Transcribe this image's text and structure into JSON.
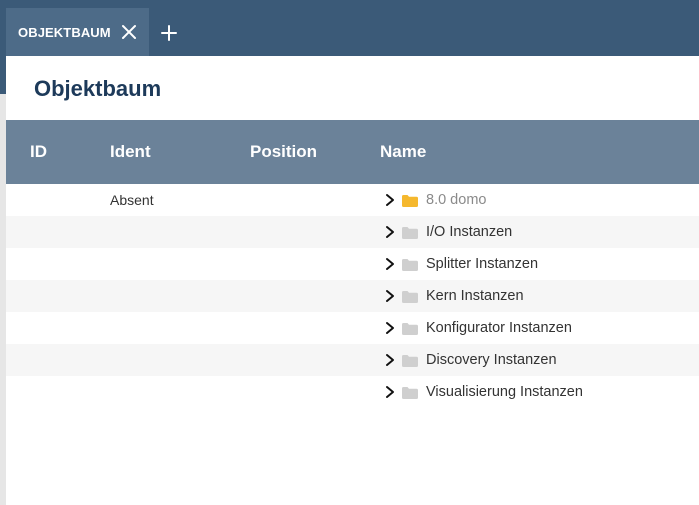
{
  "tab": {
    "label": "OBJEKTBAUM",
    "close_icon": "close-icon",
    "add_icon": "plus-icon"
  },
  "page": {
    "title": "Objektbaum"
  },
  "table": {
    "columns": [
      "ID",
      "Ident",
      "Position",
      "Name"
    ],
    "rows": [
      {
        "id": "",
        "ident": "Absent",
        "position": "",
        "name": "8.0 domo",
        "folder_color": "#f5b82e",
        "muted": true
      },
      {
        "id": "",
        "ident": "",
        "position": "",
        "name": "I/O Instanzen",
        "folder_color": "#cfcfcf",
        "muted": false
      },
      {
        "id": "",
        "ident": "",
        "position": "",
        "name": "Splitter Instanzen",
        "folder_color": "#cfcfcf",
        "muted": false
      },
      {
        "id": "",
        "ident": "",
        "position": "",
        "name": "Kern Instanzen",
        "folder_color": "#cfcfcf",
        "muted": false
      },
      {
        "id": "",
        "ident": "",
        "position": "",
        "name": "Konfigurator Instanzen",
        "folder_color": "#cfcfcf",
        "muted": false
      },
      {
        "id": "",
        "ident": "",
        "position": "",
        "name": "Discovery Instanzen",
        "folder_color": "#cfcfcf",
        "muted": false
      },
      {
        "id": "",
        "ident": "",
        "position": "",
        "name": "Visualisierung Instanzen",
        "folder_color": "#cfcfcf",
        "muted": false
      }
    ]
  },
  "colors": {
    "header_bar": "#3b5a78",
    "active_tab": "#4d6b88",
    "table_header": "#6b8299",
    "title": "#1d3a5a"
  }
}
